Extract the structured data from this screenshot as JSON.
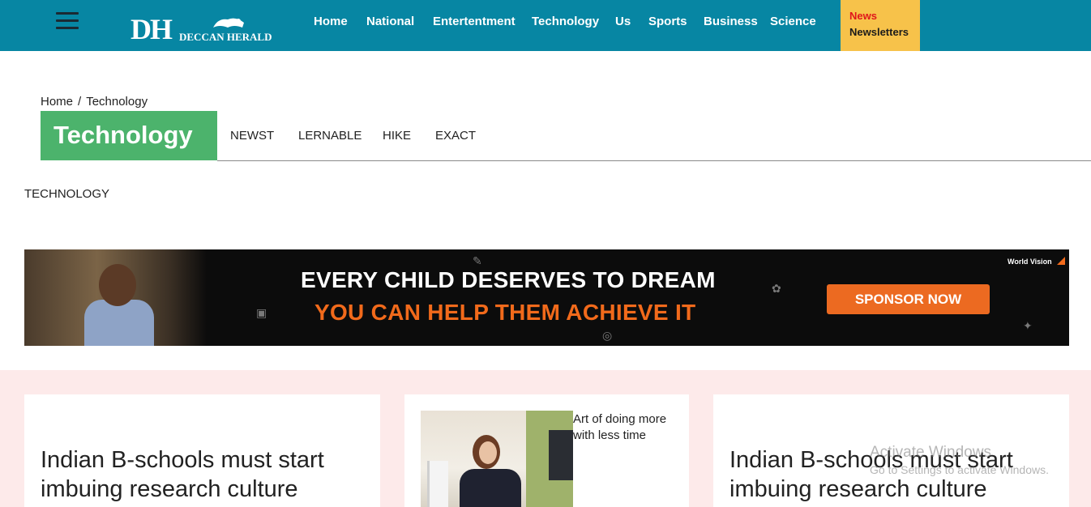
{
  "header": {
    "logo": {
      "mark": "DH",
      "name": "DECCAN HERALD"
    },
    "nav": [
      "Home",
      "National",
      "Entertentment",
      "Technology",
      "Us",
      "Sports",
      "Business",
      "Science"
    ],
    "newsletter": {
      "line1": "News",
      "line2": "Newsletters"
    }
  },
  "breadcrumb": {
    "home": "Home",
    "separator": "/",
    "current": "Technology"
  },
  "section": {
    "title": "Technology",
    "tabs": [
      "NEWST",
      "LERNABLE",
      "HIKE",
      "EXACT"
    ],
    "label": "TECHNOLOGY"
  },
  "ad": {
    "headline": "EVERY CHILD DESERVES TO DREAM",
    "subheadline": "YOU CAN HELP THEM ACHIEVE IT",
    "cta": "SPONSOR NOW",
    "brand": "World Vision"
  },
  "cards": [
    {
      "title": "Indian B-schools must start imbuing research culture"
    },
    {
      "snippet": "Art of doing more with less time"
    },
    {
      "title": "Indian B-schools must start imbuing research culture"
    }
  ],
  "watermark": {
    "line1": "Activate Windows",
    "line2": "Go to Settings to activate Windows."
  },
  "colors": {
    "header": "#0786a3",
    "newsletter": "#f7c24a",
    "section": "#4cb36c",
    "feed": "#fdeaea",
    "cta": "#ec6a21"
  }
}
